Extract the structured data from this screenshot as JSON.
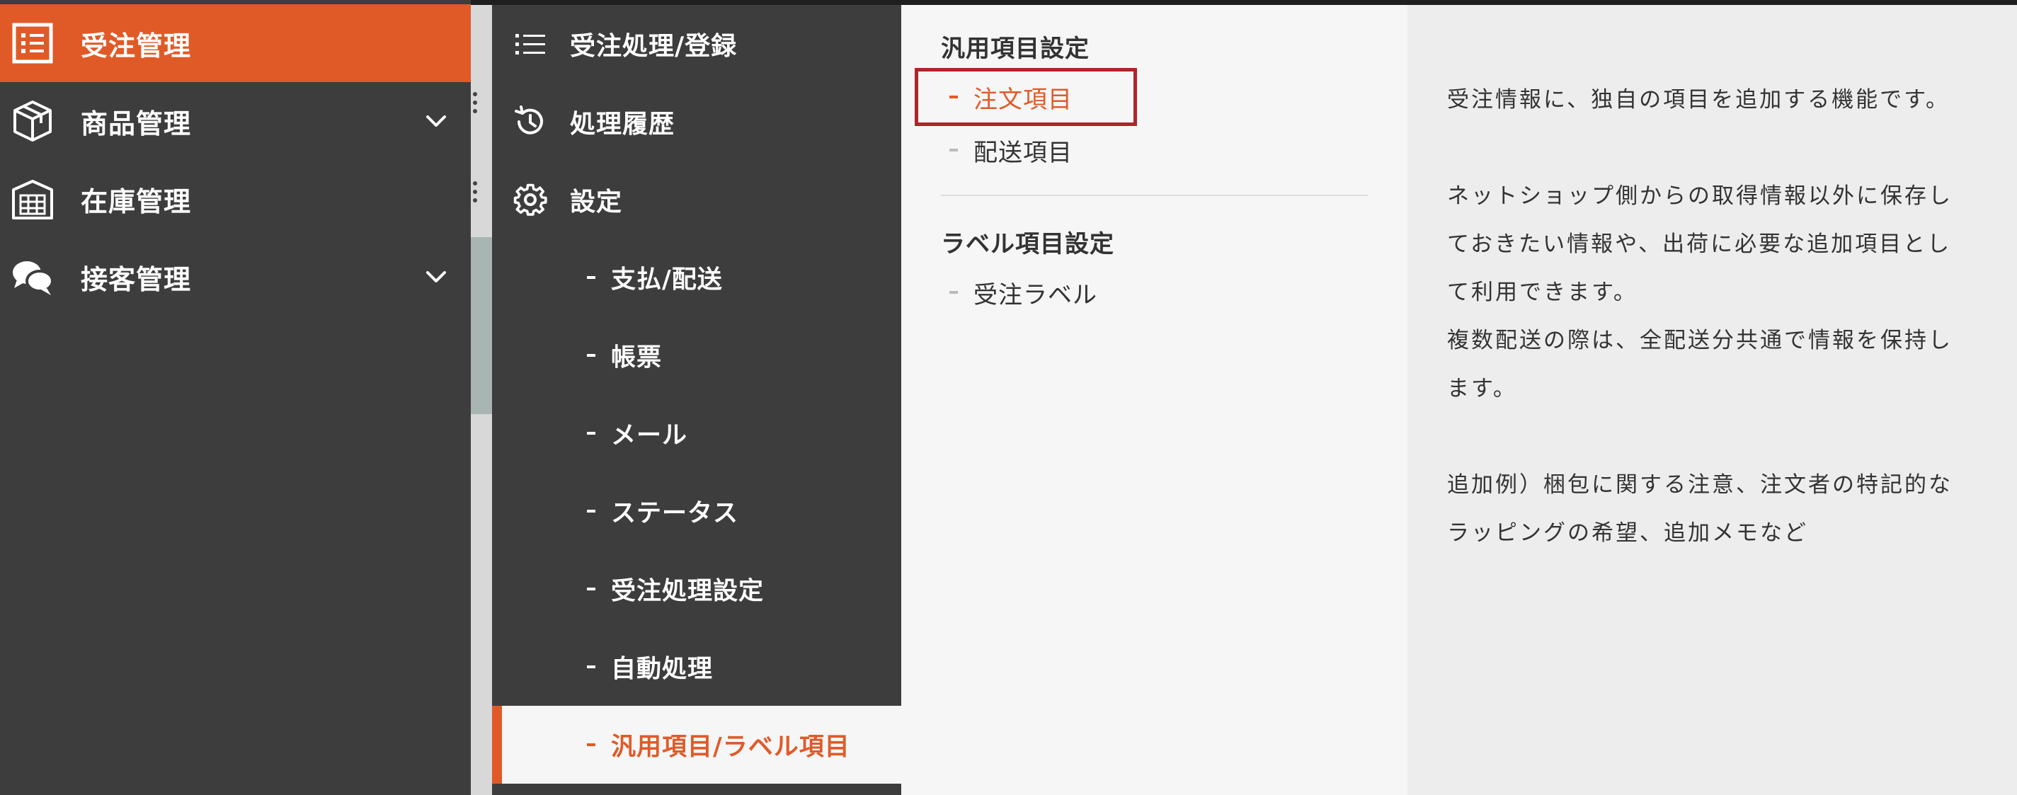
{
  "colors": {
    "accent": "#e05a28",
    "sidebar_bg": "#3d3d3d",
    "highlight_border": "#b0242a"
  },
  "sidebar": {
    "items": [
      {
        "label": "受注管理",
        "icon": "list-icon",
        "active": true,
        "expandable": false
      },
      {
        "label": "商品管理",
        "icon": "box-icon",
        "active": false,
        "expandable": true
      },
      {
        "label": "在庫管理",
        "icon": "warehouse-icon",
        "active": false,
        "expandable": false
      },
      {
        "label": "接客管理",
        "icon": "chat-icon",
        "active": false,
        "expandable": true
      }
    ]
  },
  "submenu": {
    "top_items": [
      {
        "label": "受注処理/登録",
        "icon": "list-lines-icon"
      },
      {
        "label": "処理履歴",
        "icon": "history-icon"
      },
      {
        "label": "設定",
        "icon": "gear-icon"
      }
    ],
    "settings_children": [
      {
        "label": "支払/配送"
      },
      {
        "label": "帳票"
      },
      {
        "label": "メール"
      },
      {
        "label": "ステータス"
      },
      {
        "label": "受注処理設定"
      },
      {
        "label": "自動処理"
      },
      {
        "label": "汎用項目/ラベル項目",
        "selected": true
      }
    ]
  },
  "item_settings": {
    "general_heading": "汎用項目設定",
    "general_links": [
      {
        "label": "注文項目",
        "current": true
      },
      {
        "label": "配送項目",
        "current": false
      }
    ],
    "label_heading": "ラベル項目設定",
    "label_links": [
      {
        "label": "受注ラベル",
        "current": false
      }
    ]
  },
  "description": {
    "lines": [
      "受注情報に、独自の項目を追加する機能です。",
      "",
      "ネットショップ側からの取得情報以外に保存し",
      "ておきたい情報や、出荷に必要な追加項目とし",
      "て利用できます。",
      "複数配送の際は、全配送分共通で情報を保持し",
      "ます。",
      "",
      "追加例）梱包に関する注意、注文者の特記的な",
      "ラッピングの希望、追加メモなど"
    ]
  }
}
